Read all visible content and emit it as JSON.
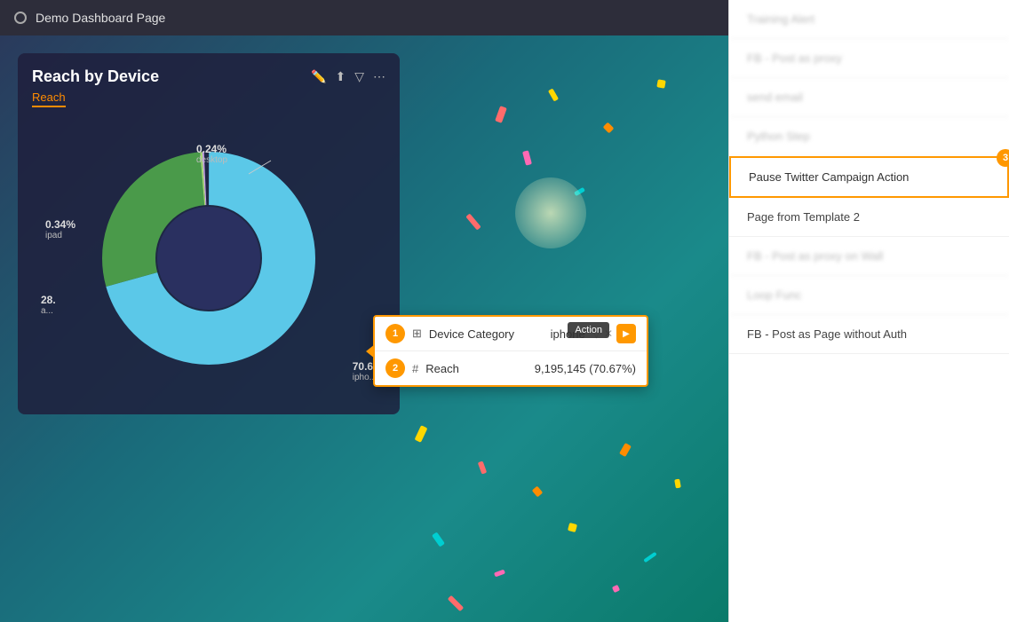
{
  "topbar": {
    "title": "Demo Dashboard Page"
  },
  "chart": {
    "title": "Reach by Device",
    "subtitle": "Reach",
    "segments": [
      {
        "label": "iphone",
        "value": 70.6,
        "percent": "70.6",
        "color": "#5bc8e8",
        "angle": 254
      },
      {
        "label": "ipad",
        "value": 0.34,
        "percent": "0.34",
        "color": "#a8d87a",
        "angle": 1.2
      },
      {
        "label": "desktop",
        "value": 0.24,
        "percent": "0.24",
        "color": "#b8a0e8",
        "angle": 0.86
      },
      {
        "label": "android",
        "value": 28,
        "percent": "28.",
        "color": "#4a9a5a",
        "angle": 100
      }
    ]
  },
  "tooltip": {
    "badge1": "1",
    "badge2": "2",
    "field_icon": "⊞",
    "field_label": "Device Category",
    "field_value": "iphone",
    "metric_icon": "#",
    "metric_label": "Reach",
    "metric_value": "9,195,145 (70.67%)",
    "action_tooltip": "Action"
  },
  "right_panel": {
    "items": [
      {
        "id": "item1",
        "label": "Training Alert",
        "blurred": true
      },
      {
        "id": "item2",
        "label": "FB - Post as proxy",
        "blurred": true
      },
      {
        "id": "item3",
        "label": "send email",
        "blurred": true
      },
      {
        "id": "item4",
        "label": "Python Step",
        "blurred": true
      },
      {
        "id": "item5",
        "label": "Pause Twitter Campaign Action",
        "highlighted": true,
        "badge": "3"
      },
      {
        "id": "item6",
        "label": "Page from Template 2",
        "normal": true
      },
      {
        "id": "item7",
        "label": "FB - Post as proxy on Wall",
        "blurred": true
      },
      {
        "id": "item8",
        "label": "Loop Func",
        "blurred": true
      },
      {
        "id": "item9",
        "label": "FB - Post as Page without Auth",
        "normal": true
      }
    ]
  }
}
